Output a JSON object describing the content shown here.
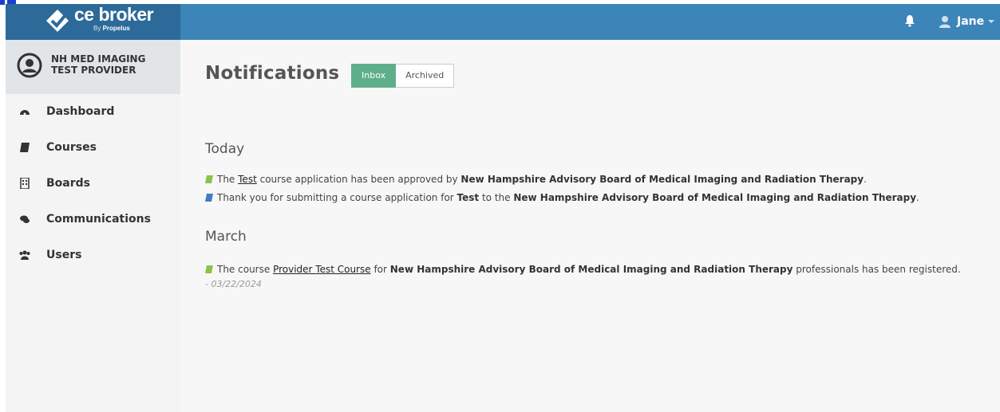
{
  "header": {
    "logo_text": "ce broker",
    "logo_sub_prefix": "By",
    "logo_sub_brand": "Propelus",
    "user_name": "Jane"
  },
  "sidebar": {
    "provider_name": "NH MED IMAGING TEST PROVIDER",
    "items": [
      {
        "label": "Dashboard",
        "icon": "dashboard-icon"
      },
      {
        "label": "Courses",
        "icon": "book-icon"
      },
      {
        "label": "Boards",
        "icon": "building-icon"
      },
      {
        "label": "Communications",
        "icon": "comments-icon"
      },
      {
        "label": "Users",
        "icon": "users-icon"
      }
    ]
  },
  "main": {
    "title": "Notifications",
    "tabs": [
      {
        "label": "Inbox",
        "active": true
      },
      {
        "label": "Archived",
        "active": false
      }
    ],
    "sections": [
      {
        "heading": "Today",
        "notes": [
          {
            "icon_color": "#8bc34a",
            "p1": "The ",
            "link": "Test",
            "p2": " course application has been approved by ",
            "bold": "New Hampshire Advisory Board of Medical Imaging and Radiation Therapy",
            "p3": "."
          },
          {
            "icon_color": "#3f7fc1",
            "p1": "Thank you for submitting a course application for ",
            "bold1": "Test",
            "p2": " to the ",
            "bold2": "New Hampshire Advisory Board of Medical Imaging and Radiation Therapy",
            "p3": "."
          }
        ]
      },
      {
        "heading": "March",
        "notes": [
          {
            "icon_color": "#8bc34a",
            "p1": "The course ",
            "link": "Provider Test Course",
            "p2": " for ",
            "bold": "New Hampshire Advisory Board of Medical Imaging and Radiation Therapy",
            "p3": " professionals has been registered.",
            "date": "- 03/22/2024"
          }
        ]
      }
    ]
  },
  "colors": {
    "topbar": "#3c85b8",
    "logo_bg": "#2c6a99",
    "inbox_active": "#5fae8a"
  }
}
